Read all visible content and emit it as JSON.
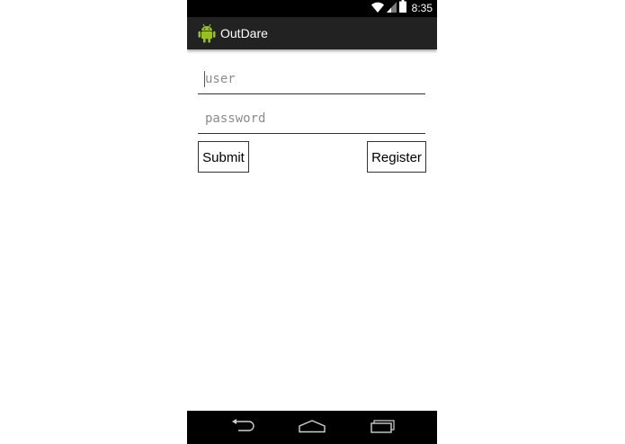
{
  "status_bar": {
    "time": "8:35",
    "icons": [
      "wifi-icon",
      "signal-icon",
      "battery-icon"
    ]
  },
  "action_bar": {
    "title": "OutDare",
    "icon": "android-icon",
    "background": "#222222"
  },
  "form": {
    "user_placeholder": "user",
    "user_value": "",
    "password_placeholder": "password",
    "password_value": "",
    "submit_label": "Submit",
    "register_label": "Register"
  },
  "nav_bar": {
    "icons": [
      "back-icon",
      "home-icon",
      "recent-apps-icon"
    ]
  },
  "colors": {
    "android_green": "#97c024",
    "status_bar": "#000000",
    "nav_bar": "#000000"
  }
}
